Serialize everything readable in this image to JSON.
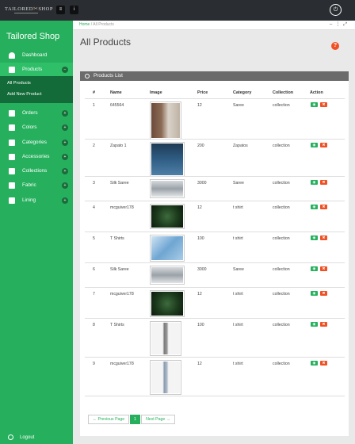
{
  "header": {
    "logo_text": "TAILORED SHOP",
    "logo_left": "TAILORED",
    "logo_mid": "✂",
    "logo_right": "SHOP",
    "menu_icon": "hamburger-icon",
    "info_icon": "info-icon",
    "power_icon": "power-icon"
  },
  "sidebar": {
    "brand": "Tailored Shop",
    "dashboard": "Dashboard",
    "products": "Products",
    "products_sub": [
      "All Products",
      "Add New Product"
    ],
    "orders": "Orders",
    "colors": "Colors",
    "categories": "Categories",
    "accessories": "Accessories",
    "collections": "Collections",
    "fabric": "Fabric",
    "lining": "Lining",
    "logout": "Logout"
  },
  "breadcrumb": {
    "home": "Home",
    "sep": "/",
    "current": "All Products"
  },
  "page": {
    "title": "All Products",
    "help_icon": "?"
  },
  "panel": {
    "title": "Products List"
  },
  "table": {
    "headers": [
      "#",
      "Name",
      "Image",
      "Price",
      "Category",
      "Collection",
      "Action"
    ],
    "rows": [
      {
        "num": "1",
        "name": "645564",
        "price": "12",
        "category": "Saree",
        "collection": "collection"
      },
      {
        "num": "2",
        "name": "Zapato 1",
        "price": "200",
        "category": "Zapatos",
        "collection": "collection"
      },
      {
        "num": "3",
        "name": "Silk Saree",
        "price": "3000",
        "category": "Saree",
        "collection": "collection"
      },
      {
        "num": "4",
        "name": "mcguiver178",
        "price": "12",
        "category": "t shirt",
        "collection": "collection"
      },
      {
        "num": "5",
        "name": "T Shirts",
        "price": "100",
        "category": "t shirt",
        "collection": "collection"
      },
      {
        "num": "6",
        "name": "Silk Saree",
        "price": "3000",
        "category": "Saree",
        "collection": "collection"
      },
      {
        "num": "7",
        "name": "mcguiver178",
        "price": "12",
        "category": "t shirt",
        "collection": "collection"
      },
      {
        "num": "8",
        "name": "T Shirts",
        "price": "100",
        "category": "t shirt",
        "collection": "collection"
      },
      {
        "num": "9",
        "name": "mcguiver178",
        "price": "12",
        "category": "t shirt",
        "collection": "collection"
      }
    ],
    "view_icon": "eye-icon",
    "delete_icon": "x-icon"
  },
  "pagination": {
    "prev": "← Previous Page",
    "current": "1",
    "next": "Next Page →"
  },
  "colors": {
    "accent": "#26b05d",
    "danger": "#f05023",
    "topbar": "#2a2d31",
    "submenu": "#126b38"
  }
}
